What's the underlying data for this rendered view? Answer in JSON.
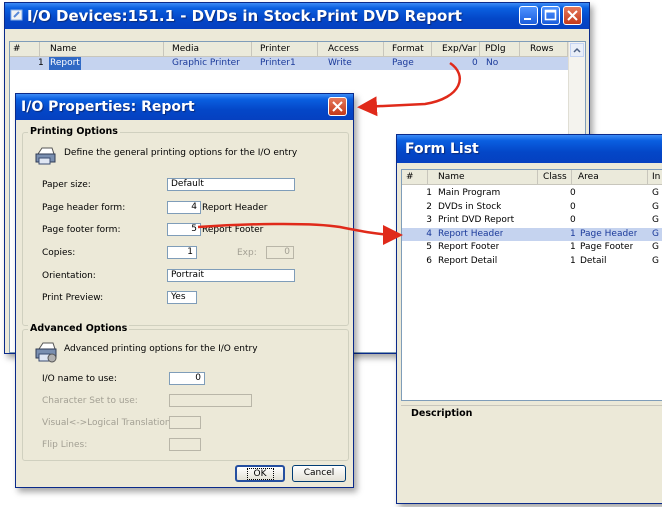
{
  "io_devices": {
    "title": "I/O Devices:151.1 -  DVDs in Stock.Print DVD Report",
    "columns": [
      "#",
      "Name",
      "Media",
      "Printer",
      "Access",
      "Format",
      "Exp/Var",
      "PDlg",
      "Rows"
    ],
    "rows": [
      {
        "num": "1",
        "name": "Report",
        "media": "Graphic Printer",
        "printer": "Printer1",
        "access": "Write",
        "format": "Page",
        "exp": "0",
        "pdlg": "No",
        "rows": ""
      }
    ]
  },
  "io_properties": {
    "title": "I/O Properties: Report",
    "printing": {
      "title": "Printing Options",
      "desc": "Define the general printing options for the I/O entry",
      "paper_size_label": "Paper size:",
      "paper_size_value": "Default",
      "header_label": "Page header form:",
      "header_num": "4",
      "header_name": "Report Header",
      "footer_label": "Page footer form:",
      "footer_num": "5",
      "footer_name": "Report Footer",
      "copies_label": "Copies:",
      "copies_value": "1",
      "exp_label": "Exp:",
      "exp_value": "0",
      "orientation_label": "Orientation:",
      "orientation_value": "Portrait",
      "preview_label": "Print Preview:",
      "preview_value": "Yes"
    },
    "advanced": {
      "title": "Advanced Options",
      "desc": "Advanced printing options for the I/O entry",
      "io_name_label": "I/O name to use:",
      "io_name_value": "0",
      "charset_label": "Character Set to use:",
      "visual_label": "Visual<->Logical Translation:",
      "flip_label": "Flip Lines:"
    },
    "ok_label": "OK",
    "cancel_label": "Cancel"
  },
  "form_list": {
    "title": "Form List",
    "columns": [
      "#",
      "Name",
      "Class",
      "Area",
      "In"
    ],
    "rows": [
      {
        "num": "1",
        "name": "Main Program",
        "class": "0",
        "area": "",
        "in": "G"
      },
      {
        "num": "2",
        "name": "DVDs in Stock",
        "class": "0",
        "area": "",
        "in": "G"
      },
      {
        "num": "3",
        "name": "Print DVD Report",
        "class": "0",
        "area": "",
        "in": "G"
      },
      {
        "num": "4",
        "name": "Report Header",
        "class": "1",
        "area": "Page Header",
        "in": "G"
      },
      {
        "num": "5",
        "name": "Report Footer",
        "class": "1",
        "area": "Page Footer",
        "in": "G"
      },
      {
        "num": "6",
        "name": "Report Detail",
        "class": "1",
        "area": "Detail",
        "in": "G"
      }
    ],
    "description_label": "Description"
  },
  "colors": {
    "accent": "#e02a1a",
    "selection": "#c5d3ef",
    "title_blue": "#0a5fe0"
  }
}
